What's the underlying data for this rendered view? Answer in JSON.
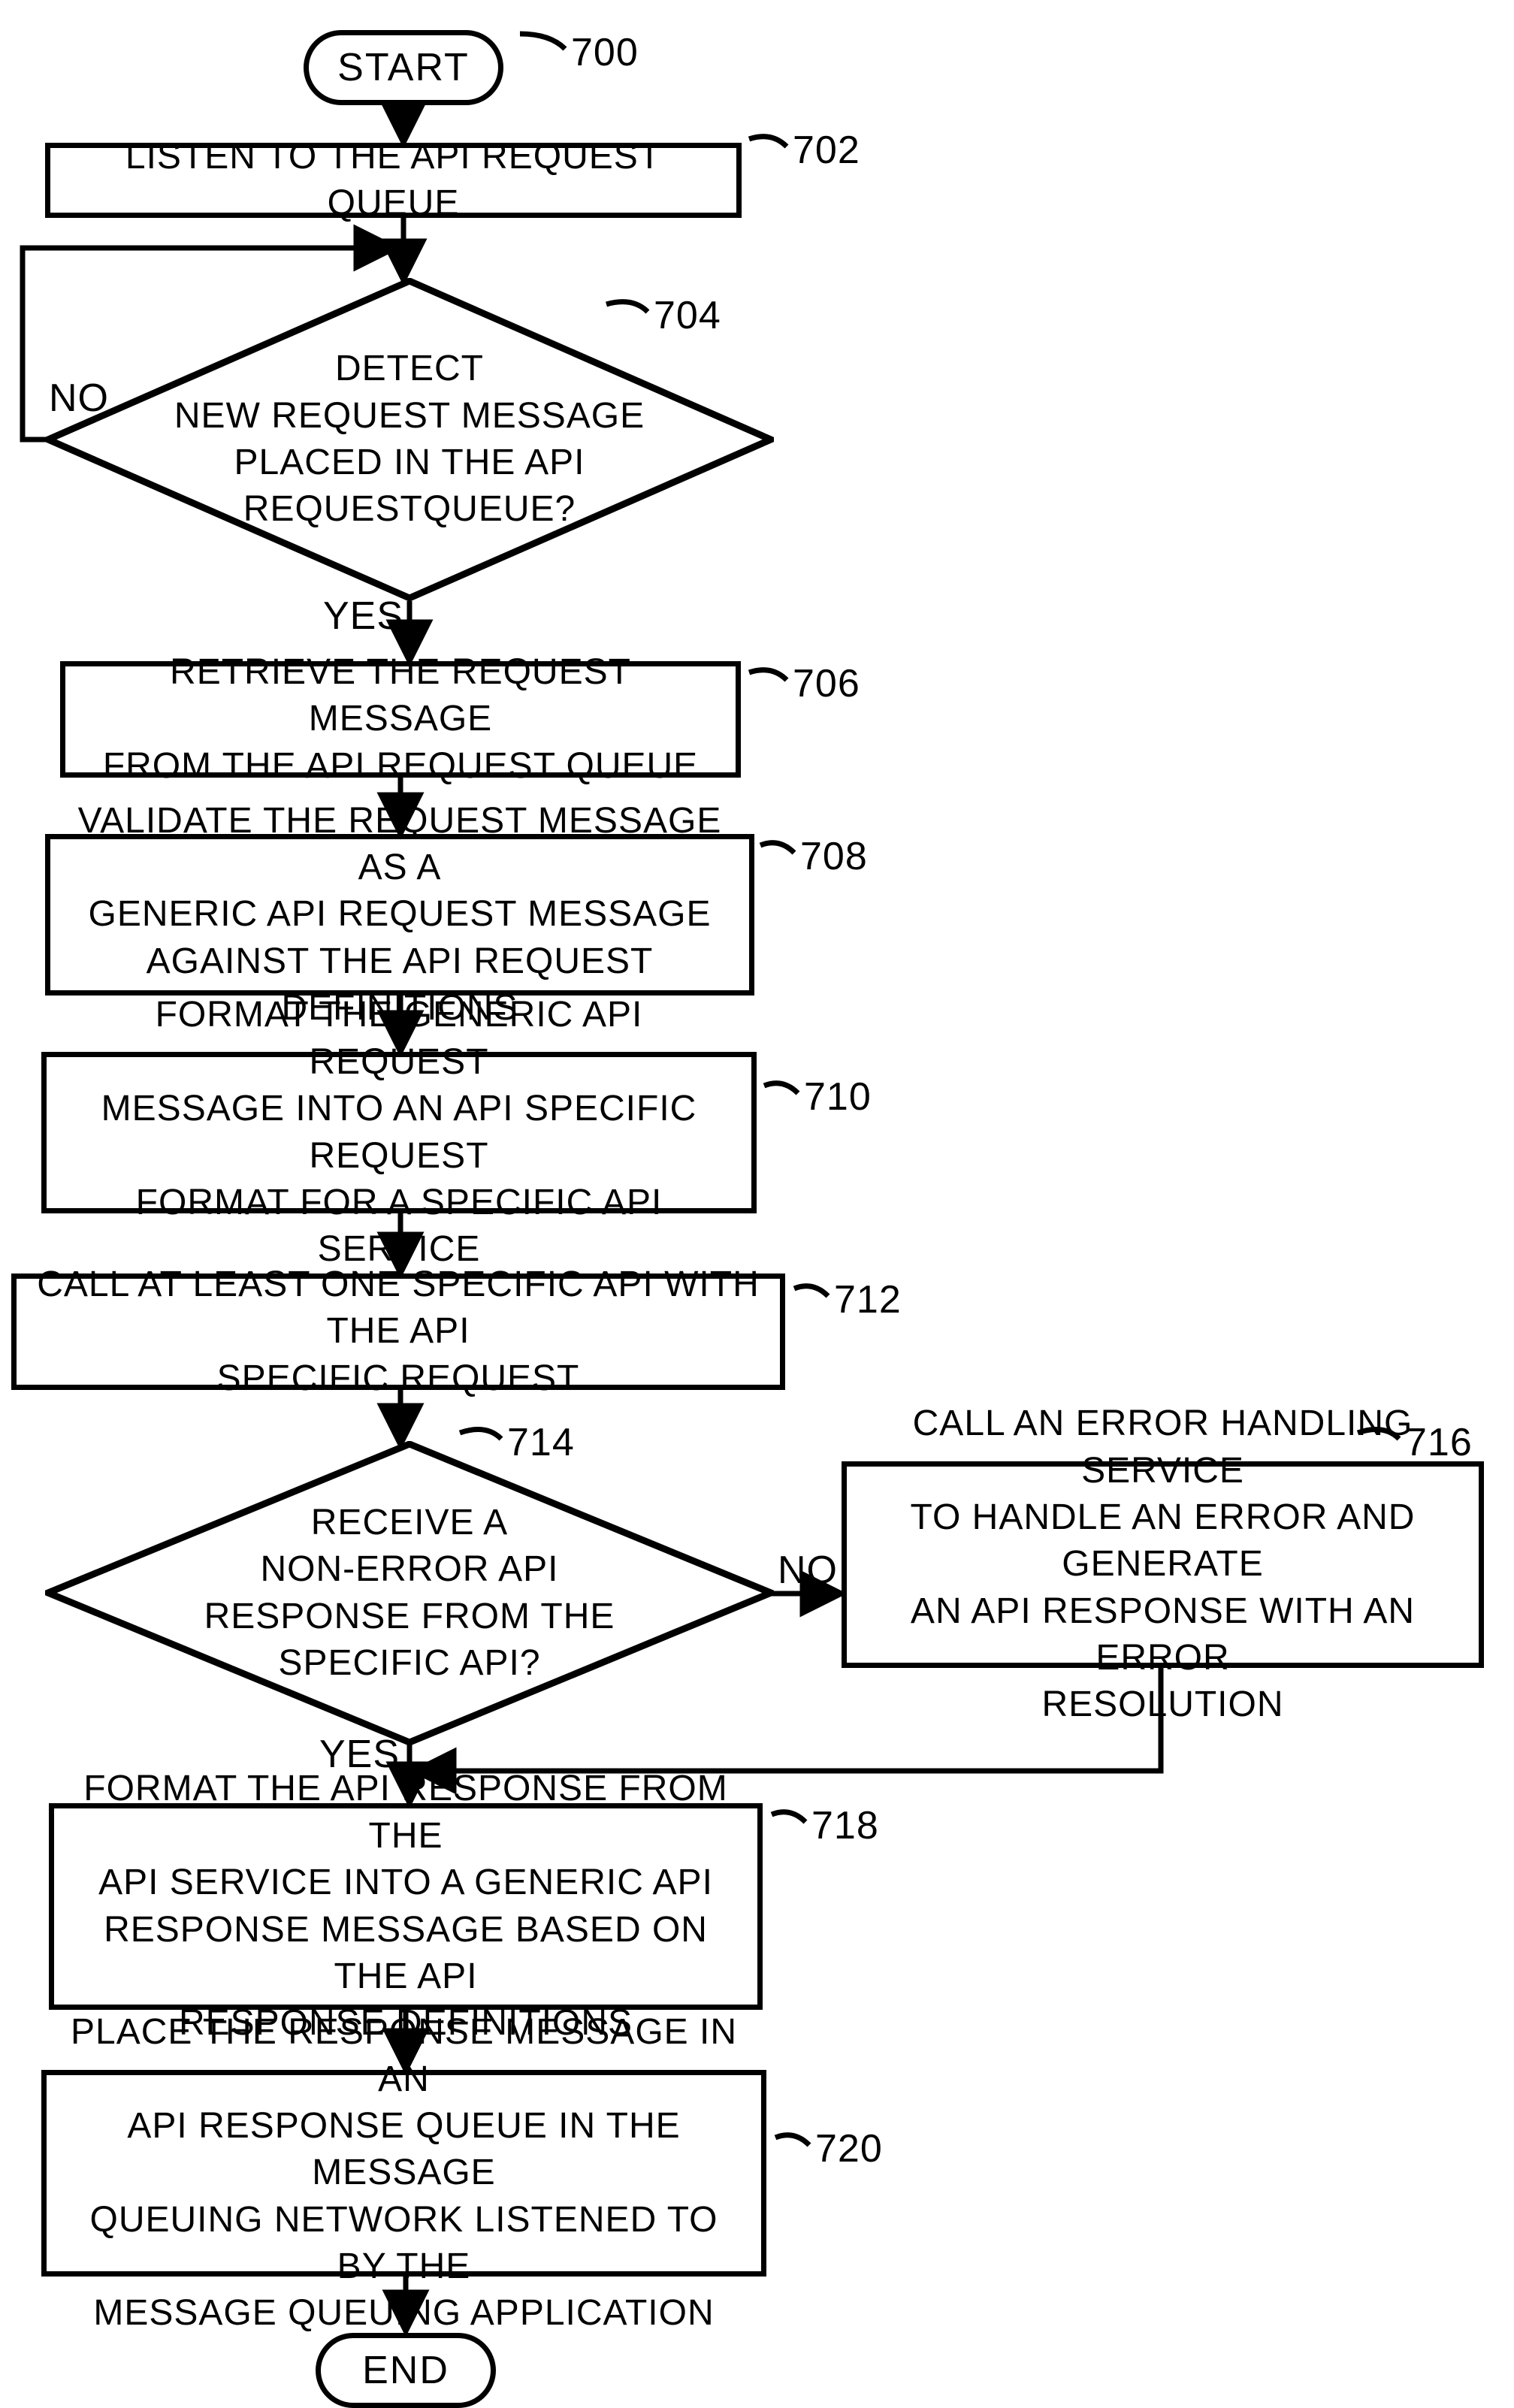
{
  "nodes": {
    "start": {
      "label": "START",
      "ref": "700"
    },
    "listen": {
      "label": "LISTEN TO THE API REQUEST QUEUE",
      "ref": "702"
    },
    "detect": {
      "label": "DETECT\nNEW REQUEST MESSAGE\nPLACED IN THE API\nREQUESTQUEUE?",
      "ref": "704"
    },
    "retrieve": {
      "label": "RETRIEVE THE REQUEST MESSAGE\nFROM THE API REQUEST QUEUE",
      "ref": "706"
    },
    "validate": {
      "label": "VALIDATE THE REQUEST MESSAGE  AS A\nGENERIC API REQUEST MESSAGE\nAGAINST THE API REQUEST DEFINITIONS",
      "ref": "708"
    },
    "format_req": {
      "label": "FORMAT THE GENERIC API REQUEST\nMESSAGE INTO AN API SPECIFIC REQUEST\nFORMAT FOR A SPECIFIC API SERVICE",
      "ref": "710"
    },
    "call": {
      "label": "CALL  AT LEAST ONE SPECIFIC API WITH THE API\nSPECIFIC REQUEST",
      "ref": "712"
    },
    "receive": {
      "label": "RECEIVE A\nNON-ERROR API\nRESPONSE FROM THE\nSPECIFIC API?",
      "ref": "714"
    },
    "error_handler": {
      "label": "CALL AN ERROR HANDLING SERVICE\nTO HANDLE AN ERROR AND GENERATE\nAN API RESPONSE WITH AN ERROR\nRESOLUTION",
      "ref": "716"
    },
    "format_resp": {
      "label": "FORMAT THE API RESPONSE FROM THE\nAPI SERVICE INTO A GENERIC API\nRESPONSE MESSAGE BASED ON THE API\nRESPONSE DEFINITIONS",
      "ref": "718"
    },
    "place": {
      "label": "PLACE THE RESPONSE MESSAGE IN AN\nAPI RESPONSE QUEUE IN THE MESSAGE\nQUEUING NETWORK LISTENED TO BY THE\nMESSAGE QUEUING APPLICATION",
      "ref": "720"
    },
    "end": {
      "label": "END"
    }
  },
  "edges": {
    "no1": "NO",
    "yes1": "YES",
    "no2": "NO",
    "yes2": "YES"
  }
}
